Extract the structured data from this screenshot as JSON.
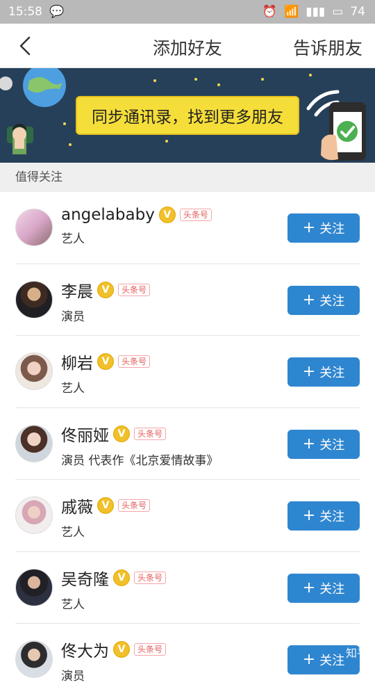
{
  "status_bar": {
    "time": "15:58",
    "battery": "74"
  },
  "nav": {
    "title": "添加好友",
    "right": "告诉朋友"
  },
  "banner": {
    "text": "同步通讯录，找到更多朋友"
  },
  "section": {
    "title": "值得关注"
  },
  "items": [
    {
      "name": "angelababy",
      "desc": "艺人",
      "tag": "头条号",
      "button": "关注",
      "avatar": "#d9a7c8"
    },
    {
      "name": "李晨",
      "desc": "演员",
      "tag": "头条号",
      "button": "关注",
      "avatar": "#5b4639"
    },
    {
      "name": "柳岩",
      "desc": "艺人",
      "tag": "头条号",
      "button": "关注",
      "avatar": "#e9c7b8"
    },
    {
      "name": "佟丽娅",
      "desc": "演员 代表作《北京爱情故事》",
      "tag": "头条号",
      "button": "关注",
      "avatar": "#cfd6dd"
    },
    {
      "name": "戚薇",
      "desc": "艺人",
      "tag": "头条号",
      "button": "关注",
      "avatar": "#ead7d2"
    },
    {
      "name": "吴奇隆",
      "desc": "艺人",
      "tag": "头条号",
      "button": "关注",
      "avatar": "#3e4150"
    },
    {
      "name": "佟大为",
      "desc": "演员",
      "tag": "头条号",
      "button": "关注",
      "avatar": "#d9dde4"
    }
  ],
  "watermark": "知乎"
}
